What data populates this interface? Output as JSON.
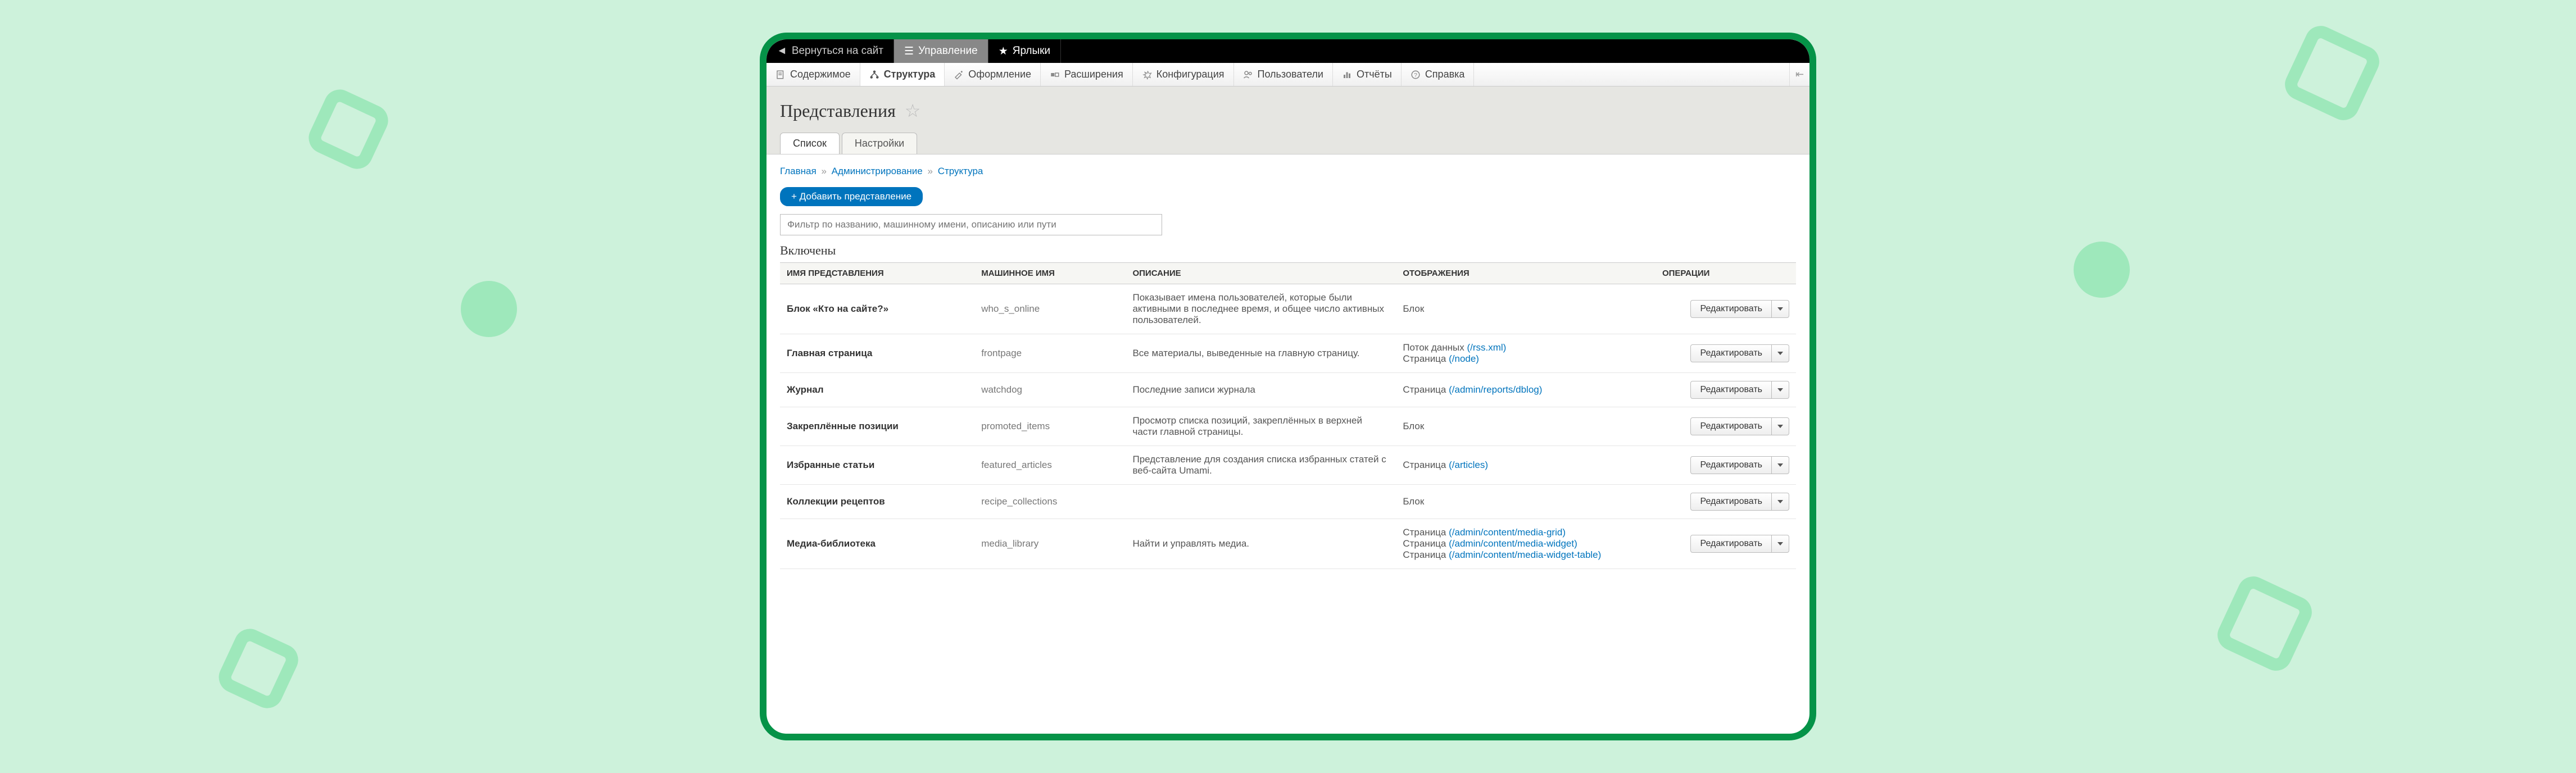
{
  "toolbar": {
    "back": "Вернуться на сайт",
    "manage": "Управление",
    "shortcuts": "Ярлыки"
  },
  "adminbar": {
    "content": "Содержимое",
    "structure": "Структура",
    "appearance": "Оформление",
    "extend": "Расширения",
    "config": "Конфигурация",
    "people": "Пользователи",
    "reports": "Отчёты",
    "help": "Справка"
  },
  "page_title": "Представления",
  "tabs": {
    "list": "Список",
    "settings": "Настройки"
  },
  "breadcrumb": {
    "home": "Главная",
    "admin": "Администрирование",
    "structure": "Структура"
  },
  "add_button": "+ Добавить представление",
  "filter_placeholder": "Фильтр по названию, машинному имени, описанию или пути",
  "section_title": "Включены",
  "columns": {
    "name": "ИМЯ ПРЕДСТАВЛЕНИЯ",
    "machine": "МАШИННОЕ ИМЯ",
    "description": "ОПИСАНИЕ",
    "displays": "ОТОБРАЖЕНИЯ",
    "operations": "ОПЕРАЦИИ"
  },
  "edit_label": "Редактировать",
  "rows": [
    {
      "name": "Блок «Кто на сайте?»",
      "machine": "who_s_online",
      "description": "Показывает имена пользователей, которые были активными в последнее время, и общее число активных пользователей.",
      "displays": [
        {
          "text": "Блок"
        }
      ]
    },
    {
      "name": "Главная страница",
      "machine": "frontpage",
      "description": "Все материалы, выведенные на главную страницу.",
      "displays": [
        {
          "text": "Поток данных ",
          "link": "(/rss.xml)"
        },
        {
          "text": "Страница ",
          "link": "(/node)"
        }
      ]
    },
    {
      "name": "Журнал",
      "machine": "watchdog",
      "description": "Последние записи журнала",
      "displays": [
        {
          "text": "Страница ",
          "link": "(/admin/reports/dblog)"
        }
      ]
    },
    {
      "name": "Закреплённые позиции",
      "machine": "promoted_items",
      "description": "Просмотр списка позиций, закреплённых в верхней части главной страницы.",
      "displays": [
        {
          "text": "Блок"
        }
      ]
    },
    {
      "name": "Избранные статьи",
      "machine": "featured_articles",
      "description": "Представление для создания списка избранных статей с веб-сайта Umami.",
      "displays": [
        {
          "text": "Страница ",
          "link": "(/articles)"
        }
      ]
    },
    {
      "name": "Коллекции рецептов",
      "machine": "recipe_collections",
      "description": "",
      "displays": [
        {
          "text": "Блок"
        }
      ]
    },
    {
      "name": "Медиа-библиотека",
      "machine": "media_library",
      "description": "Найти и управлять медиа.",
      "displays": [
        {
          "text": "Страница ",
          "link": "(/admin/content/media-grid)"
        },
        {
          "text": "Страница ",
          "link": "(/admin/content/media-widget)"
        },
        {
          "text": "Страница ",
          "link": "(/admin/content/media-widget-table)"
        }
      ]
    }
  ]
}
